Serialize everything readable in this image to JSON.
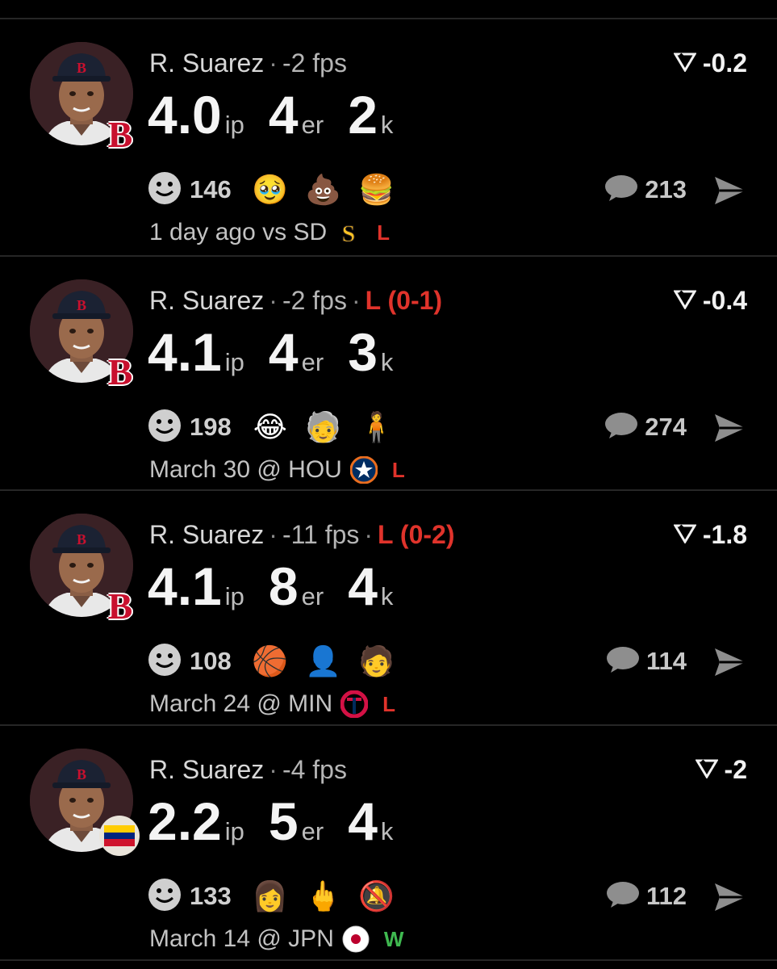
{
  "colors": {
    "background": "#000000",
    "loss": "#e0332b",
    "win": "#3fb950",
    "team": "#c8102e"
  },
  "posts": [
    {
      "player": "R. Suarez",
      "separator": "·",
      "fps": "-2 fps",
      "decision": "",
      "score": "-0.2",
      "stats": [
        {
          "value": "4.0",
          "unit": "ip"
        },
        {
          "value": "4",
          "unit": "er"
        },
        {
          "value": "2",
          "unit": "k"
        }
      ],
      "reaction_count": "146",
      "reaction_emojis": [
        "relieved-tear-face",
        "poop",
        "hamburger"
      ],
      "comment_count": "213",
      "game": "1 day ago vs SD",
      "opponent_icon": "padres-logo",
      "outcome": "L",
      "badge": "team-logo"
    },
    {
      "player": "R. Suarez",
      "separator": "·",
      "fps": "-2 fps",
      "decision": "L (0-1)",
      "score": "-0.4",
      "stats": [
        {
          "value": "4.1",
          "unit": "ip"
        },
        {
          "value": "4",
          "unit": "er"
        },
        {
          "value": "3",
          "unit": "k"
        }
      ],
      "reaction_count": "198",
      "reaction_emojis": [
        "crying-laughing",
        "old-person-cane",
        "person-standing"
      ],
      "comment_count": "274",
      "game": "March 30 @ HOU",
      "opponent_icon": "astros-logo",
      "outcome": "L",
      "badge": "team-logo"
    },
    {
      "player": "R. Suarez",
      "separator": "·",
      "fps": "-11 fps",
      "decision": "L (0-2)",
      "score": "-1.8",
      "stats": [
        {
          "value": "4.1",
          "unit": "ip"
        },
        {
          "value": "8",
          "unit": "er"
        },
        {
          "value": "4",
          "unit": "k"
        }
      ],
      "reaction_count": "108",
      "reaction_emojis": [
        "basketball-net",
        "dark-face",
        "portrait"
      ],
      "comment_count": "114",
      "game": "March 24 @ MIN",
      "opponent_icon": "twins-logo",
      "outcome": "L",
      "badge": "team-logo"
    },
    {
      "player": "R. Suarez",
      "separator": "·",
      "fps": "-4 fps",
      "decision": "",
      "score": "-2",
      "stats": [
        {
          "value": "2.2",
          "unit": "ip"
        },
        {
          "value": "5",
          "unit": "er"
        },
        {
          "value": "4",
          "unit": "k"
        }
      ],
      "reaction_count": "133",
      "reaction_emojis": [
        "person-portrait",
        "middle-finger",
        "bell-slash"
      ],
      "comment_count": "112",
      "game": "March 14 @ JPN",
      "opponent_icon": "japan-flag",
      "outcome": "W",
      "badge": "venezuela-flag"
    }
  ]
}
